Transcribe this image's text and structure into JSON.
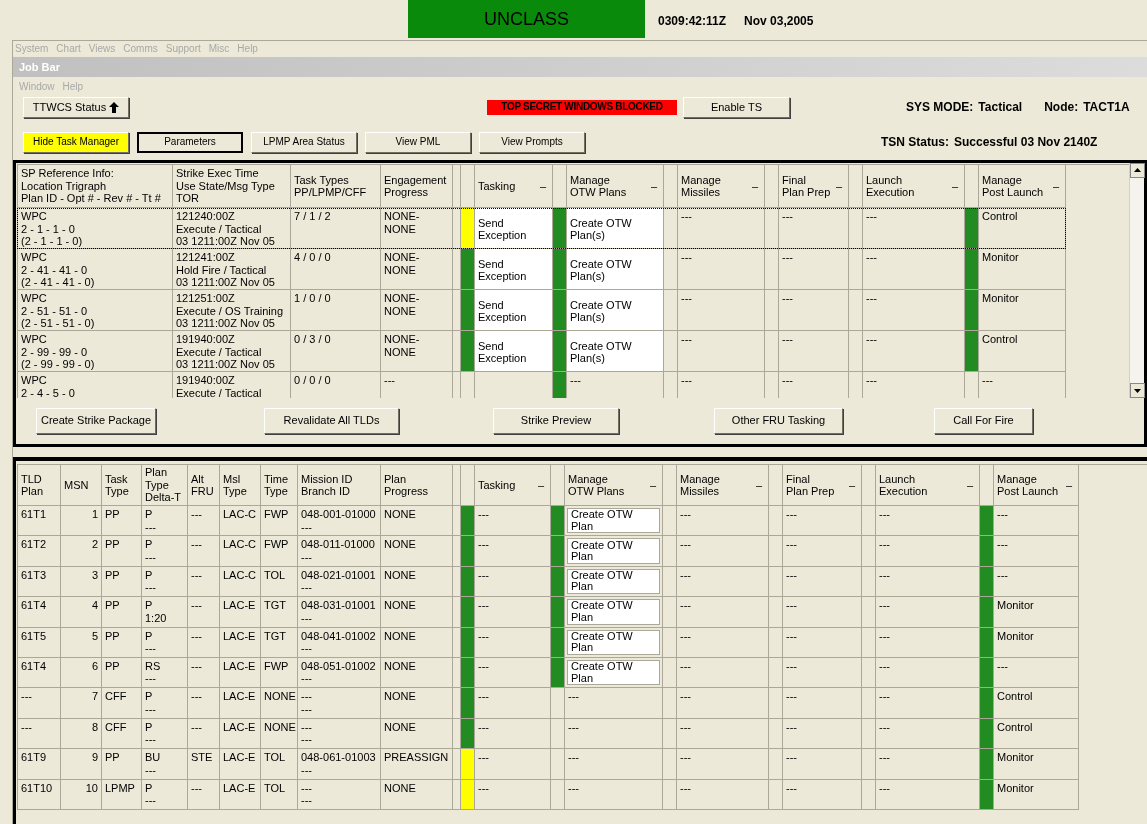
{
  "banner": {
    "classification": "UNCLASS",
    "time": "0309:42:11Z",
    "date": "Nov 03,2005"
  },
  "main_menu": [
    {
      "label": "System",
      "disabled": true
    },
    {
      "label": "Chart",
      "disabled": true
    },
    {
      "label": "Views",
      "disabled": true
    },
    {
      "label": "Comms",
      "disabled": true
    },
    {
      "label": "Support",
      "disabled": true
    },
    {
      "label": "Misc",
      "disabled": true
    },
    {
      "label": "Help",
      "disabled": true
    }
  ],
  "window": {
    "title": "Job Bar"
  },
  "window_menu": [
    {
      "label": "Window",
      "disabled": true
    },
    {
      "label": "Help",
      "disabled": true
    }
  ],
  "toolbar": {
    "status_button": {
      "label": "TTWCS Status"
    },
    "alert": "TOP SECRET WINDOWS BLOCKED",
    "enable_button": "Enable TS",
    "sys_mode_label": "SYS MODE:",
    "sys_mode": "Tactical",
    "node_label": "Node:",
    "node": "TACT1A",
    "buttons": [
      {
        "label": "Hide Task Manager",
        "active": true,
        "focused": false
      },
      {
        "label": "Parameters",
        "active": false,
        "focused": true
      },
      {
        "label": "LPMP Area Status",
        "active": false,
        "focused": false
      },
      {
        "label": "View PML",
        "active": false,
        "focused": false
      },
      {
        "label": "View Prompts",
        "active": false,
        "focused": false
      }
    ],
    "tsn_label": "TSN Status:",
    "tsn": "Successful 03 Nov 2140Z"
  },
  "strike_table": {
    "columns": [
      {
        "lines": [
          "SP Reference Info:",
          "Location Trigraph",
          "Plan ID - Opt # - Rev # - Tt #"
        ]
      },
      {
        "lines": [
          "Strike Exec Time",
          "Use State/Msg Type",
          "TOR"
        ]
      },
      {
        "lines": [
          "Task Types",
          "PP/LPMP/CFF"
        ]
      },
      {
        "lines": [
          "Engagement",
          "Progress"
        ]
      },
      {
        "kind": "stage",
        "lines": [
          "Tasking"
        ],
        "toggle": "–"
      },
      {
        "kind": "stage",
        "lines": [
          "Manage",
          "OTW Plans"
        ],
        "toggle": "–"
      },
      {
        "kind": "stage",
        "lines": [
          "Manage",
          "Missiles"
        ],
        "toggle": "–"
      },
      {
        "kind": "stage",
        "lines": [
          "Final",
          "Plan Prep"
        ],
        "toggle": "–"
      },
      {
        "kind": "stage",
        "lines": [
          "Launch",
          "Execution"
        ],
        "toggle": "–"
      },
      {
        "kind": "stage",
        "lines": [
          "Manage",
          "Post Launch"
        ],
        "toggle": "–"
      }
    ],
    "rows": [
      {
        "selected": true,
        "cells": [
          {
            "lines": [
              "WPC",
              "2 - 1 - 1 - 0",
              "(2 - 1 - 1 - 0)"
            ]
          },
          {
            "lines": [
              "121240:00Z",
              "Execute / Tactical",
              "03 1211:00Z Nov 05"
            ]
          },
          {
            "lines": [
              "7 / 1 / 2"
            ]
          },
          {
            "lines": [
              "NONE-",
              "NONE"
            ]
          },
          {
            "color": "#ffff00",
            "kind": "action",
            "lines": [
              "Send",
              "Exception"
            ]
          },
          {
            "color": "#228b22",
            "kind": "action",
            "lines": [
              "Create OTW",
              "Plan(s)"
            ]
          },
          {
            "lines": [
              "---"
            ]
          },
          {
            "lines": [
              "---"
            ]
          },
          {
            "lines": [
              "---"
            ]
          },
          {
            "color": "#228b22",
            "lines": [
              "Control"
            ]
          }
        ]
      },
      {
        "selected": false,
        "cells": [
          {
            "lines": [
              "WPC",
              "2 - 41 - 41 - 0",
              "(2 - 41 - 41 - 0)"
            ]
          },
          {
            "lines": [
              "121241:00Z",
              "Hold Fire / Tactical",
              "03 1211:00Z Nov 05"
            ]
          },
          {
            "lines": [
              "4 / 0 / 0"
            ]
          },
          {
            "lines": [
              "NONE-",
              "NONE"
            ]
          },
          {
            "color": "#228b22",
            "kind": "action",
            "lines": [
              "Send",
              "Exception"
            ]
          },
          {
            "color": "#228b22",
            "kind": "action",
            "lines": [
              "Create OTW",
              "Plan(s)"
            ]
          },
          {
            "lines": [
              "---"
            ]
          },
          {
            "lines": [
              "---"
            ]
          },
          {
            "lines": [
              "---"
            ]
          },
          {
            "color": "#228b22",
            "lines": [
              "Monitor"
            ]
          }
        ]
      },
      {
        "selected": false,
        "cells": [
          {
            "lines": [
              "WPC",
              "2 - 51 - 51 - 0",
              "(2 - 51 - 51 - 0)"
            ]
          },
          {
            "lines": [
              "121251:00Z",
              "Execute / OS Training",
              "03 1211:00Z Nov 05"
            ]
          },
          {
            "lines": [
              "1 / 0 / 0"
            ]
          },
          {
            "lines": [
              "NONE-",
              "NONE"
            ]
          },
          {
            "color": "#228b22",
            "kind": "action",
            "lines": [
              "Send",
              "Exception"
            ]
          },
          {
            "color": "#228b22",
            "kind": "action",
            "lines": [
              "Create OTW",
              "Plan(s)"
            ]
          },
          {
            "lines": [
              "---"
            ]
          },
          {
            "lines": [
              "---"
            ]
          },
          {
            "lines": [
              "---"
            ]
          },
          {
            "color": "#228b22",
            "lines": [
              "Monitor"
            ]
          }
        ]
      },
      {
        "selected": false,
        "cells": [
          {
            "lines": [
              "WPC",
              "2 - 99 - 99 - 0",
              "(2 - 99 - 99 - 0)"
            ]
          },
          {
            "lines": [
              "191940:00Z",
              "Execute / Tactical",
              "03 1211:00Z Nov 05"
            ]
          },
          {
            "lines": [
              "0 / 3 / 0"
            ]
          },
          {
            "lines": [
              "NONE-",
              "NONE"
            ]
          },
          {
            "color": "#228b22",
            "kind": "action",
            "lines": [
              "Send",
              "Exception"
            ]
          },
          {
            "color": "#228b22",
            "kind": "action",
            "lines": [
              "Create OTW",
              "Plan(s)"
            ]
          },
          {
            "lines": [
              "---"
            ]
          },
          {
            "lines": [
              "---"
            ]
          },
          {
            "lines": [
              "---"
            ]
          },
          {
            "color": "#228b22",
            "lines": [
              "Control"
            ]
          }
        ]
      },
      {
        "selected": false,
        "cells": [
          {
            "lines": [
              "WPC",
              "2 - 4 - 5 - 0"
            ]
          },
          {
            "lines": [
              "191940:00Z",
              "Execute / Tactical"
            ]
          },
          {
            "lines": [
              "0 / 0 / 0"
            ]
          },
          {
            "lines": [
              "---"
            ]
          },
          {},
          {
            "color": "#228b22",
            "lines": [
              "---"
            ]
          },
          {
            "lines": [
              "---"
            ]
          },
          {
            "lines": [
              "---"
            ]
          },
          {
            "lines": [
              "---"
            ]
          },
          {
            "lines": [
              "---"
            ]
          }
        ]
      }
    ],
    "buttons": [
      "Create Strike Package",
      "Revalidate All TLDs",
      "Strike Preview",
      "Other FRU Tasking",
      "Call For Fire"
    ]
  },
  "tld_table": {
    "columns": [
      {
        "lines": [
          "TLD",
          "Plan"
        ]
      },
      {
        "lines": [
          "MSN"
        ]
      },
      {
        "lines": [
          "Task",
          "Type"
        ]
      },
      {
        "lines": [
          "Plan",
          "Type",
          "Delta-T"
        ]
      },
      {
        "lines": [
          "Alt",
          "FRU"
        ]
      },
      {
        "lines": [
          "Msl",
          "Type"
        ]
      },
      {
        "lines": [
          "Time",
          "Type"
        ]
      },
      {
        "lines": [
          "Mission ID",
          "Branch ID"
        ]
      },
      {
        "lines": [
          "Plan",
          "Progress"
        ]
      },
      {
        "kind": "stage",
        "lines": [
          "Tasking"
        ],
        "toggle": "–"
      },
      {
        "kind": "stage",
        "lines": [
          "Manage",
          "OTW Plans"
        ],
        "toggle": "–"
      },
      {
        "kind": "stage",
        "lines": [
          "Manage",
          "Missiles"
        ],
        "toggle": "–"
      },
      {
        "kind": "stage",
        "lines": [
          "Final",
          "Plan Prep"
        ],
        "toggle": "–"
      },
      {
        "kind": "stage",
        "lines": [
          "Launch",
          "Execution"
        ],
        "toggle": "–"
      },
      {
        "kind": "stage",
        "lines": [
          "Manage",
          "Post Launch"
        ],
        "toggle": "–"
      }
    ],
    "rows": [
      {
        "cells": [
          {
            "lines": [
              "61T1"
            ]
          },
          {
            "lines": [
              "1"
            ]
          },
          {
            "lines": [
              "PP"
            ]
          },
          {
            "lines": [
              "P",
              "---"
            ]
          },
          {
            "lines": [
              "---"
            ]
          },
          {
            "lines": [
              "LAC-C"
            ]
          },
          {
            "lines": [
              "FWP"
            ]
          },
          {
            "lines": [
              "048-001-01000",
              "---"
            ]
          },
          {
            "lines": [
              "NONE"
            ]
          },
          {
            "color": "#228b22",
            "lines": [
              "---"
            ]
          },
          {
            "color": "#228b22",
            "kind": "action",
            "lines": [
              "Create OTW",
              "Plan"
            ]
          },
          {
            "lines": [
              "---"
            ]
          },
          {
            "lines": [
              "---"
            ]
          },
          {
            "lines": [
              "---"
            ]
          },
          {
            "color": "#228b22",
            "lines": [
              "---"
            ]
          }
        ]
      },
      {
        "cells": [
          {
            "lines": [
              "61T2"
            ]
          },
          {
            "lines": [
              "2"
            ]
          },
          {
            "lines": [
              "PP"
            ]
          },
          {
            "lines": [
              "P",
              "---"
            ]
          },
          {
            "lines": [
              "---"
            ]
          },
          {
            "lines": [
              "LAC-C"
            ]
          },
          {
            "lines": [
              "FWP"
            ]
          },
          {
            "lines": [
              "048-011-01000",
              "---"
            ]
          },
          {
            "lines": [
              "NONE"
            ]
          },
          {
            "color": "#228b22",
            "lines": [
              "---"
            ]
          },
          {
            "color": "#228b22",
            "kind": "action",
            "lines": [
              "Create OTW",
              "Plan"
            ]
          },
          {
            "lines": [
              "---"
            ]
          },
          {
            "lines": [
              "---"
            ]
          },
          {
            "lines": [
              "---"
            ]
          },
          {
            "color": "#228b22",
            "lines": [
              "---"
            ]
          }
        ]
      },
      {
        "cells": [
          {
            "lines": [
              "61T3"
            ]
          },
          {
            "lines": [
              "3"
            ]
          },
          {
            "lines": [
              "PP"
            ]
          },
          {
            "lines": [
              "P",
              "---"
            ]
          },
          {
            "lines": [
              "---"
            ]
          },
          {
            "lines": [
              "LAC-C"
            ]
          },
          {
            "lines": [
              "TOL"
            ]
          },
          {
            "lines": [
              "048-021-01001",
              "---"
            ]
          },
          {
            "lines": [
              "NONE"
            ]
          },
          {
            "color": "#228b22",
            "lines": [
              "---"
            ]
          },
          {
            "color": "#228b22",
            "kind": "action",
            "lines": [
              "Create OTW",
              "Plan"
            ]
          },
          {
            "lines": [
              "---"
            ]
          },
          {
            "lines": [
              "---"
            ]
          },
          {
            "lines": [
              "---"
            ]
          },
          {
            "color": "#228b22",
            "lines": [
              "---"
            ]
          }
        ]
      },
      {
        "cells": [
          {
            "lines": [
              "61T4"
            ]
          },
          {
            "lines": [
              "4"
            ]
          },
          {
            "lines": [
              "PP"
            ]
          },
          {
            "lines": [
              "P",
              "1:20"
            ]
          },
          {
            "lines": [
              "---"
            ]
          },
          {
            "lines": [
              "LAC-E"
            ]
          },
          {
            "lines": [
              "TGT"
            ]
          },
          {
            "lines": [
              "048-031-01001",
              "---"
            ]
          },
          {
            "lines": [
              "NONE"
            ]
          },
          {
            "color": "#228b22",
            "lines": [
              "---"
            ]
          },
          {
            "color": "#228b22",
            "kind": "action",
            "lines": [
              "Create OTW",
              "Plan"
            ]
          },
          {
            "lines": [
              "---"
            ]
          },
          {
            "lines": [
              "---"
            ]
          },
          {
            "lines": [
              "---"
            ]
          },
          {
            "color": "#228b22",
            "lines": [
              "Monitor"
            ]
          }
        ]
      },
      {
        "cells": [
          {
            "lines": [
              "61T5"
            ]
          },
          {
            "lines": [
              "5"
            ]
          },
          {
            "lines": [
              "PP"
            ]
          },
          {
            "lines": [
              "P",
              "---"
            ]
          },
          {
            "lines": [
              "---"
            ]
          },
          {
            "lines": [
              "LAC-E"
            ]
          },
          {
            "lines": [
              "TGT"
            ]
          },
          {
            "lines": [
              "048-041-01002",
              "---"
            ]
          },
          {
            "lines": [
              "NONE"
            ]
          },
          {
            "color": "#228b22",
            "lines": [
              "---"
            ]
          },
          {
            "color": "#228b22",
            "kind": "action",
            "lines": [
              "Create OTW",
              "Plan"
            ]
          },
          {
            "lines": [
              "---"
            ]
          },
          {
            "lines": [
              "---"
            ]
          },
          {
            "lines": [
              "---"
            ]
          },
          {
            "color": "#228b22",
            "lines": [
              "Monitor"
            ]
          }
        ]
      },
      {
        "cells": [
          {
            "lines": [
              "61T4"
            ]
          },
          {
            "lines": [
              "6"
            ]
          },
          {
            "lines": [
              "PP"
            ]
          },
          {
            "lines": [
              "RS",
              "---"
            ]
          },
          {
            "lines": [
              "---"
            ]
          },
          {
            "lines": [
              "LAC-E"
            ]
          },
          {
            "lines": [
              "FWP"
            ]
          },
          {
            "lines": [
              "048-051-01002",
              "---"
            ]
          },
          {
            "lines": [
              "NONE"
            ]
          },
          {
            "color": "#228b22",
            "lines": [
              "---"
            ]
          },
          {
            "color": "#228b22",
            "kind": "action",
            "lines": [
              "Create OTW",
              "Plan"
            ]
          },
          {
            "lines": [
              "---"
            ]
          },
          {
            "lines": [
              "---"
            ]
          },
          {
            "lines": [
              "---"
            ]
          },
          {
            "color": "#228b22",
            "lines": [
              "---"
            ]
          }
        ]
      },
      {
        "cells": [
          {
            "lines": [
              "---"
            ]
          },
          {
            "lines": [
              "7"
            ]
          },
          {
            "lines": [
              "CFF"
            ]
          },
          {
            "lines": [
              "P",
              "---"
            ]
          },
          {
            "lines": [
              "---"
            ]
          },
          {
            "lines": [
              "LAC-E"
            ]
          },
          {
            "lines": [
              "NONE"
            ]
          },
          {
            "lines": [
              "---",
              "---"
            ]
          },
          {
            "lines": [
              "NONE"
            ]
          },
          {
            "color": "#228b22",
            "lines": [
              "---"
            ]
          },
          {
            "lines": [
              "---"
            ]
          },
          {
            "lines": [
              "---"
            ]
          },
          {
            "lines": [
              "---"
            ]
          },
          {
            "lines": [
              "---"
            ]
          },
          {
            "color": "#228b22",
            "lines": [
              "Control"
            ]
          }
        ]
      },
      {
        "cells": [
          {
            "lines": [
              "---"
            ]
          },
          {
            "lines": [
              "8"
            ]
          },
          {
            "lines": [
              "CFF"
            ]
          },
          {
            "lines": [
              "P",
              "---"
            ]
          },
          {
            "lines": [
              "---"
            ]
          },
          {
            "lines": [
              "LAC-E"
            ]
          },
          {
            "lines": [
              "NONE"
            ]
          },
          {
            "lines": [
              "---",
              "---"
            ]
          },
          {
            "lines": [
              "NONE"
            ]
          },
          {
            "color": "#228b22",
            "lines": [
              "---"
            ]
          },
          {
            "lines": [
              "---"
            ]
          },
          {
            "lines": [
              "---"
            ]
          },
          {
            "lines": [
              "---"
            ]
          },
          {
            "lines": [
              "---"
            ]
          },
          {
            "color": "#228b22",
            "lines": [
              "Control"
            ]
          }
        ]
      },
      {
        "cells": [
          {
            "lines": [
              "61T9"
            ]
          },
          {
            "lines": [
              "9"
            ]
          },
          {
            "lines": [
              "PP"
            ]
          },
          {
            "lines": [
              "BU",
              "---"
            ]
          },
          {
            "lines": [
              "STE"
            ]
          },
          {
            "lines": [
              "LAC-E"
            ]
          },
          {
            "lines": [
              "TOL"
            ]
          },
          {
            "lines": [
              "048-061-01003",
              "---"
            ]
          },
          {
            "lines": [
              "PREASSIGN"
            ]
          },
          {
            "color": "#ffff00",
            "lines": [
              "---"
            ]
          },
          {
            "lines": [
              "---"
            ]
          },
          {
            "lines": [
              "---"
            ]
          },
          {
            "lines": [
              "---"
            ]
          },
          {
            "lines": [
              "---"
            ]
          },
          {
            "color": "#228b22",
            "lines": [
              "Monitor"
            ]
          }
        ]
      },
      {
        "cells": [
          {
            "lines": [
              "61T10"
            ]
          },
          {
            "lines": [
              "10"
            ]
          },
          {
            "lines": [
              "LPMP"
            ]
          },
          {
            "lines": [
              "P",
              "---"
            ]
          },
          {
            "lines": [
              "---"
            ]
          },
          {
            "lines": [
              "LAC-E"
            ]
          },
          {
            "lines": [
              "TOL"
            ]
          },
          {
            "lines": [
              "---",
              "---"
            ]
          },
          {
            "lines": [
              "NONE"
            ]
          },
          {
            "color": "#ffff00",
            "lines": [
              "---"
            ]
          },
          {
            "lines": [
              "---"
            ]
          },
          {
            "lines": [
              "---"
            ]
          },
          {
            "lines": [
              "---"
            ]
          },
          {
            "lines": [
              "---"
            ]
          },
          {
            "color": "#228b22",
            "lines": [
              "Monitor"
            ]
          }
        ]
      }
    ]
  }
}
